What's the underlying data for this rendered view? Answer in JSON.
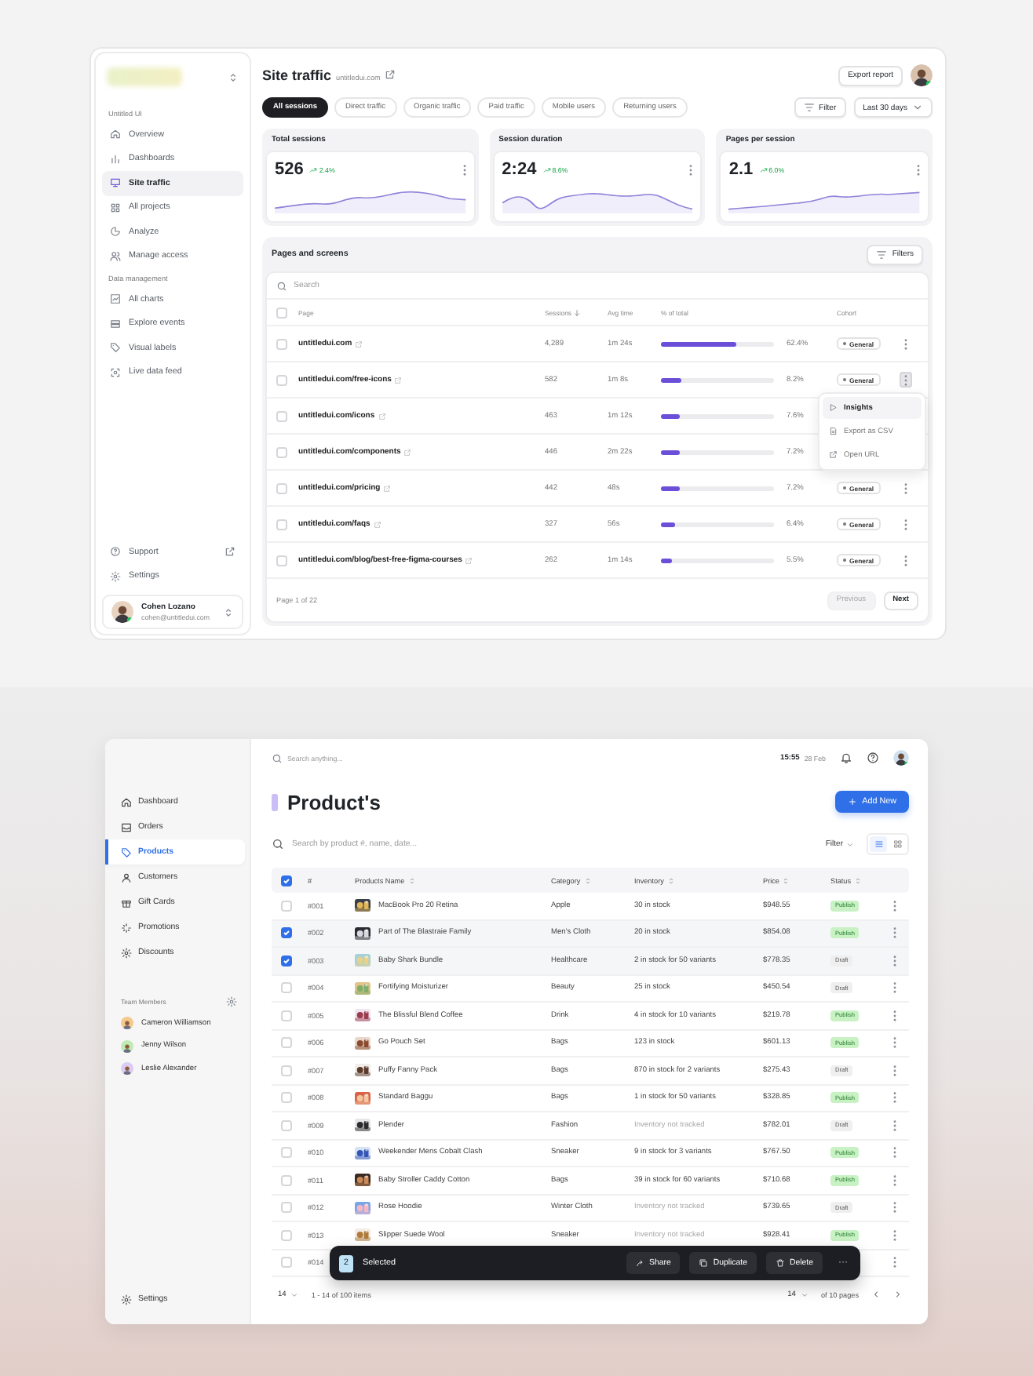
{
  "traffic": {
    "sidebar": {
      "groups": [
        {
          "heading": "Untitled UI",
          "items": [
            {
              "label": "Overview",
              "selected": false
            },
            {
              "label": "Dashboards",
              "selected": false
            },
            {
              "label": "Site traffic",
              "selected": true
            },
            {
              "label": "All projects",
              "selected": false
            },
            {
              "label": "Analyze",
              "selected": false
            },
            {
              "label": "Manage access",
              "selected": false
            }
          ]
        },
        {
          "heading": "Data management",
          "items": [
            {
              "label": "All charts",
              "selected": false
            },
            {
              "label": "Explore events",
              "selected": false
            },
            {
              "label": "Visual labels",
              "selected": false
            },
            {
              "label": "Live data feed",
              "selected": false
            }
          ]
        }
      ],
      "footer_items": [
        {
          "label": "Support",
          "selected": false
        },
        {
          "label": "Settings",
          "selected": false
        }
      ],
      "user": {
        "name": "Cohen Lozano",
        "email": "cohen@untitledui.com"
      }
    },
    "title": "Site traffic",
    "domain": "untitledui.com",
    "export_button": "Export report",
    "tabs": [
      {
        "label": "All sessions",
        "selected": true
      },
      {
        "label": "Direct traffic",
        "selected": false
      },
      {
        "label": "Organic traffic",
        "selected": false
      },
      {
        "label": "Paid traffic",
        "selected": false
      },
      {
        "label": "Mobile users",
        "selected": false
      },
      {
        "label": "Returning users",
        "selected": false
      }
    ],
    "filter_button": "Filter",
    "date_range": "Last 30 days",
    "metrics": [
      {
        "title": "Total sessions",
        "value": "526",
        "change": "2.4%"
      },
      {
        "title": "Session duration",
        "value": "2:24",
        "change": "8.6%"
      },
      {
        "title": "Pages per session",
        "value": "2.1",
        "change": "6.0%"
      }
    ],
    "table": {
      "title": "Pages and screens",
      "filters_button": "Filters",
      "search_placeholder": "Search",
      "select_all": false,
      "columns": [
        "Page",
        "Sessions",
        "Avg time",
        "% of total",
        "Cohort"
      ],
      "rows": [
        {
          "page": "untitledui.com",
          "sessions": "4,289",
          "avg_time": "1m 24s",
          "level": 0.66,
          "percent": "62.4%",
          "cohort": "General",
          "menu_open": false,
          "checked": false
        },
        {
          "page": "untitledui.com/free-icons",
          "sessions": "582",
          "avg_time": "1m 8s",
          "level": 0.18,
          "percent": "8.2%",
          "cohort": "General",
          "menu_open": true,
          "checked": false
        },
        {
          "page": "untitledui.com/icons",
          "sessions": "463",
          "avg_time": "1m 12s",
          "level": 0.17,
          "percent": "7.6%",
          "checked": false
        },
        {
          "page": "untitledui.com/components",
          "sessions": "446",
          "avg_time": "2m 22s",
          "level": 0.16,
          "percent": "7.2%",
          "checked": false
        },
        {
          "page": "untitledui.com/pricing",
          "sessions": "442",
          "avg_time": "48s",
          "level": 0.16,
          "percent": "7.2%",
          "cohort": "General",
          "menu_open": false,
          "checked": false
        },
        {
          "page": "untitledui.com/faqs",
          "sessions": "327",
          "avg_time": "56s",
          "level": 0.13,
          "percent": "6.4%",
          "cohort": "General",
          "menu_open": false,
          "checked": false
        },
        {
          "page": "untitledui.com/blog/best-free-figma-courses",
          "sessions": "262",
          "avg_time": "1m 14s",
          "level": 0.1,
          "percent": "5.5%",
          "cohort": "General",
          "menu_open": false,
          "checked": false
        }
      ],
      "page_info": "Page 1 of 22",
      "pager": [
        {
          "label": "Previous",
          "disabled": true
        },
        {
          "label": "Next",
          "disabled": false
        }
      ]
    },
    "row_menu": {
      "items": [
        {
          "label": "Insights",
          "selected": true
        },
        {
          "label": "Export as CSV",
          "selected": false
        },
        {
          "label": "Open URL",
          "selected": false
        }
      ]
    }
  },
  "products": {
    "sidebar": {
      "items": [
        {
          "label": "Dashboard",
          "selected": false
        },
        {
          "label": "Orders",
          "selected": false
        },
        {
          "label": "Products",
          "selected": true
        },
        {
          "label": "Customers",
          "selected": false
        },
        {
          "label": "Gift Cards",
          "selected": false
        },
        {
          "label": "Promotions",
          "selected": false
        },
        {
          "label": "Discounts",
          "selected": false
        }
      ],
      "team_heading": "Team Members",
      "members": [
        {
          "name": "Cameron Williamson",
          "color": "#f5c98c"
        },
        {
          "name": "Jenny Wilson",
          "color": "#bfe9b5"
        },
        {
          "name": "Leslie Alexander",
          "color": "#dccbf2"
        }
      ],
      "settings": "Settings"
    },
    "search_placeholder": "Search anything...",
    "time": "15:55",
    "date": "28 Feb",
    "title": "Product's",
    "add_button": "Add New",
    "table_search_placeholder": "Search by product #, name, date...",
    "filter": "Filter",
    "views": [
      {
        "kind": "list",
        "selected": true
      },
      {
        "kind": "grid",
        "selected": false
      }
    ],
    "select_all": true,
    "columns": [
      "#",
      "Products Name",
      "Category",
      "Inventory",
      "Price",
      "Status"
    ],
    "rows": [
      {
        "id": "#001",
        "name": "MacBook Pro 20 Retina",
        "category": "Apple",
        "inventory": "30 in stock",
        "tracked": true,
        "price": "$948.55",
        "status": "Publish",
        "published": true,
        "checked": false
      },
      {
        "id": "#002",
        "name": "Part of The Blastraie Family",
        "category": "Men's Cloth",
        "inventory": "20 in stock",
        "tracked": true,
        "price": "$854.08",
        "status": "Publish",
        "published": true,
        "checked": true
      },
      {
        "id": "#003",
        "name": "Baby Shark Bundle",
        "category": "Healthcare",
        "inventory": "2 in stock for 50 variants",
        "tracked": true,
        "price": "$778.35",
        "status": "Draft",
        "published": false,
        "checked": true
      },
      {
        "id": "#004",
        "name": "Fortifying Moisturizer",
        "category": "Beauty",
        "inventory": "25 in stock",
        "tracked": true,
        "price": "$450.54",
        "status": "Draft",
        "published": false,
        "checked": false
      },
      {
        "id": "#005",
        "name": "The Blissful Blend Coffee",
        "category": "Drink",
        "inventory": "4 in stock for 10 variants",
        "tracked": true,
        "price": "$219.78",
        "status": "Publish",
        "published": true,
        "checked": false
      },
      {
        "id": "#006",
        "name": "Go Pouch Set",
        "category": "Bags",
        "inventory": "123 in stock",
        "tracked": true,
        "price": "$601.13",
        "status": "Publish",
        "published": true,
        "checked": false
      },
      {
        "id": "#007",
        "name": "Puffy Fanny Pack",
        "category": "Bags",
        "inventory": "870 in stock for 2 variants",
        "tracked": true,
        "price": "$275.43",
        "status": "Draft",
        "published": false,
        "checked": false
      },
      {
        "id": "#008",
        "name": "Standard Baggu",
        "category": "Bags",
        "inventory": "1 in stock for 50 variants",
        "tracked": true,
        "price": "$328.85",
        "status": "Publish",
        "published": true,
        "checked": false
      },
      {
        "id": "#009",
        "name": "Plender",
        "category": "Fashion",
        "inventory": "Inventory not tracked",
        "tracked": false,
        "price": "$782.01",
        "status": "Draft",
        "published": false,
        "checked": false
      },
      {
        "id": "#010",
        "name": "Weekender Mens Cobalt Clash",
        "category": "Sneaker",
        "inventory": "9 in stock for 3 variants",
        "tracked": true,
        "price": "$767.50",
        "status": "Publish",
        "published": true,
        "checked": false
      },
      {
        "id": "#011",
        "name": "Baby Stroller Caddy Cotton",
        "category": "Bags",
        "inventory": "39 in stock for 60 variants",
        "tracked": true,
        "price": "$710.68",
        "status": "Publish",
        "published": true,
        "checked": false
      },
      {
        "id": "#012",
        "name": "Rose Hoodie",
        "category": "Winter Cloth",
        "inventory": "Inventory not tracked",
        "tracked": false,
        "price": "$739.65",
        "status": "Draft",
        "published": false,
        "checked": false
      },
      {
        "id": "#013",
        "name": "Slipper Suede Wool",
        "category": "Sneaker",
        "inventory": "Inventory not tracked",
        "tracked": false,
        "price": "$928.41",
        "status": "Publish",
        "published": true,
        "checked": false
      },
      {
        "id": "#014",
        "checked": false
      }
    ],
    "selection": {
      "count": "2",
      "label": "Selected",
      "actions": [
        "Share",
        "Duplicate",
        "Delete"
      ],
      "more": "···"
    },
    "footer": {
      "page_size": "14",
      "range": "1 - 14 of 100 items",
      "page_select": "14",
      "pages": "of 10 pages"
    }
  }
}
